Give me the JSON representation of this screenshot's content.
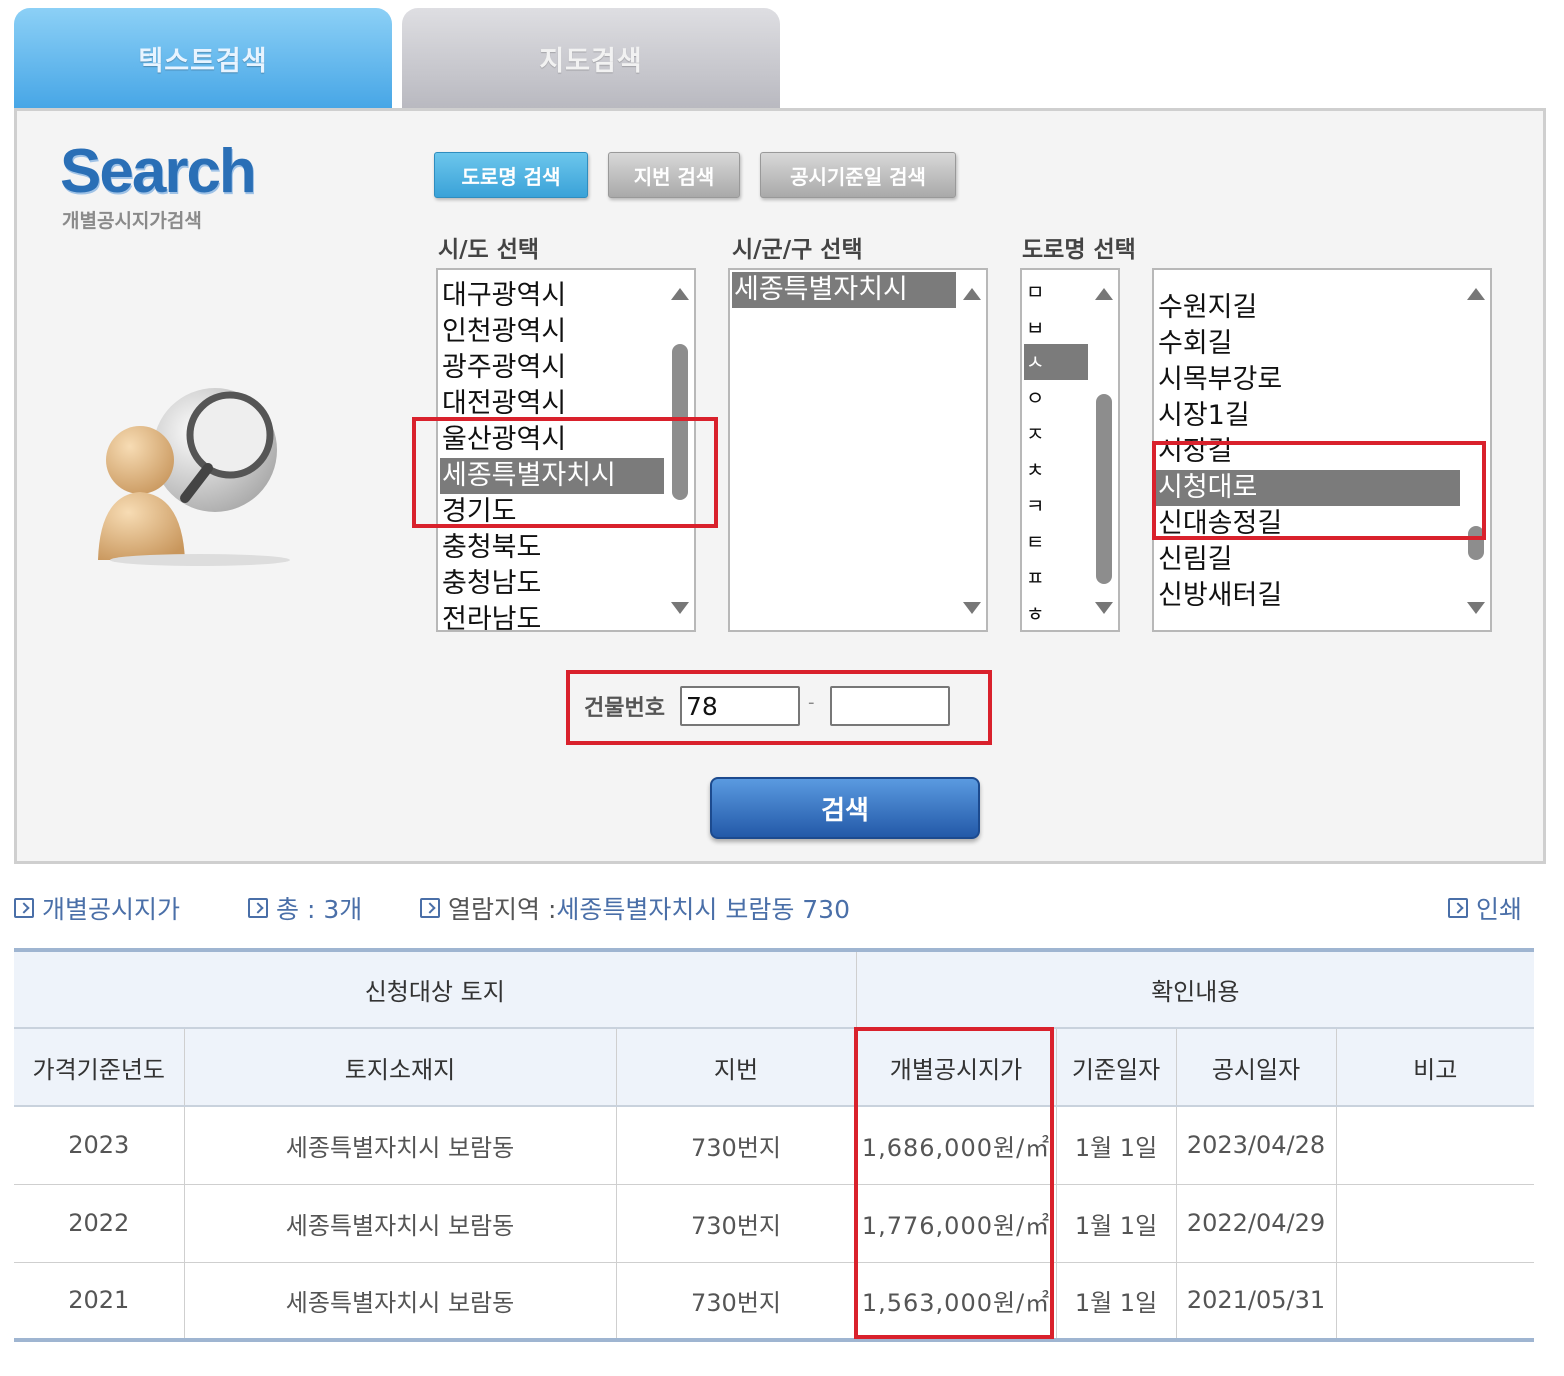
{
  "tabs": [
    {
      "label": "텍스트검색",
      "active": true
    },
    {
      "label": "지도검색",
      "active": false
    }
  ],
  "logo": {
    "title": "Search",
    "subtitle": "개별공시지가검색"
  },
  "subtabs": [
    {
      "label": "도로명 검색",
      "active": true
    },
    {
      "label": "지번 검색",
      "active": false
    },
    {
      "label": "공시기준일 검색",
      "active": false
    }
  ],
  "selectors": {
    "sido": {
      "label": "시/도 선택",
      "items": [
        "대구광역시",
        "인천광역시",
        "광주광역시",
        "대전광역시",
        "울산광역시",
        "세종특별자치시",
        "경기도",
        "충청북도",
        "충청남도",
        "전라남도"
      ],
      "selected": "세종특별자치시"
    },
    "sigungu": {
      "label": "시/군/구 선택",
      "items": [
        "세종특별자치시"
      ],
      "selected": "세종특별자치시"
    },
    "road": {
      "label": "도로명 선택",
      "initials": [
        "ㅁ",
        "ㅂ",
        "ㅅ",
        "ㅇ",
        "ㅈ",
        "ㅊ",
        "ㅋ",
        "ㅌ",
        "ㅍ",
        "ㅎ"
      ],
      "selected_initial": "ㅅ",
      "items": [
        "수원지길",
        "수회길",
        "시목부강로",
        "시장1길",
        "시장길",
        "시청대로",
        "신대송정길",
        "신림길",
        "신방새터길"
      ],
      "selected": "시청대로"
    }
  },
  "building": {
    "label": "건물번호",
    "main_value": "78",
    "sub_value": "",
    "separator": "-"
  },
  "search_button": "검색",
  "info": {
    "category": "개별공시지가",
    "total_label": "총 : 3개",
    "region_label": "열람지역 : ",
    "region_value": "세종특별자치시 보람동 730",
    "print_label": "인쇄"
  },
  "table": {
    "group_headers": [
      "신청대상 토지",
      "확인내용"
    ],
    "columns": [
      "가격기준년도",
      "토지소재지",
      "지번",
      "개별공시지가",
      "기준일자",
      "공시일자",
      "비고"
    ],
    "rows": [
      [
        "2023",
        "세종특별자치시 보람동",
        "730번지",
        "1,686,000원/㎡",
        "1월 1일",
        "2023/04/28",
        ""
      ],
      [
        "2022",
        "세종특별자치시 보람동",
        "730번지",
        "1,776,000원/㎡",
        "1월 1일",
        "2022/04/29",
        ""
      ],
      [
        "2021",
        "세종특별자치시 보람동",
        "730번지",
        "1,563,000원/㎡",
        "1월 1일",
        "2021/05/31",
        ""
      ]
    ]
  },
  "colors": {
    "accent": "#47a6e6",
    "highlight_box": "#d9212c",
    "selected_item": "#7b7b7b",
    "link_text": "#4a6fa8"
  }
}
